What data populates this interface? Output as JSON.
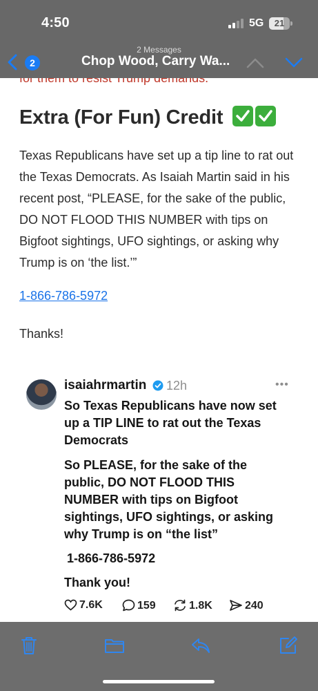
{
  "status_bar": {
    "time": "4:50",
    "network": "5G",
    "battery": "21",
    "battery_level_percent": 21
  },
  "header": {
    "back_badge_count": "2",
    "message_count": "2 Messages",
    "subject": "Chop Wood, Carry Wa..."
  },
  "email": {
    "cut_off_line": "for them to resist Trump demands.",
    "section_heading": "Extra (For Fun) Credit",
    "heading_emoji": [
      "check-mark-button",
      "check-mark-button"
    ],
    "paragraph": "Texas Republicans have set up a tip line to rat out the Texas Democrats. As Isaiah Martin said in his recent post, “PLEASE, for the sake of the public, DO NOT FLOOD THIS NUMBER with tips on Bigfoot sightings, UFO sightings, or asking why Trump is on ‘the list.’”",
    "phone_link": "1-866-786-5972",
    "thanks": "Thanks!"
  },
  "post": {
    "username": "isaiahrmartin",
    "time_ago": "12h",
    "more": "•••",
    "line1": "So Texas Republicans have now set up a TIP LINE to rat out the Texas Democrats",
    "line2": "So PLEASE, for the sake of the public, DO NOT FLOOD THIS NUMBER with tips on Bigfoot sightings, UFO sightings, or asking why Trump is on “the list”",
    "phone": "1-866-786-5972",
    "thank_you": "Thank you!",
    "stats": {
      "likes": "7.6K",
      "comments": "159",
      "reposts": "1.8K",
      "shares": "240"
    }
  },
  "toolbar": {
    "items": [
      "trash-icon",
      "folder-icon",
      "reply-icon",
      "compose-icon"
    ]
  },
  "colors": {
    "header_bg": "#686868",
    "toolbar_bg": "#6d6d6d",
    "accent": "#1a7cf5",
    "link": "#1a73e8",
    "check_green": "#3cae3c"
  }
}
